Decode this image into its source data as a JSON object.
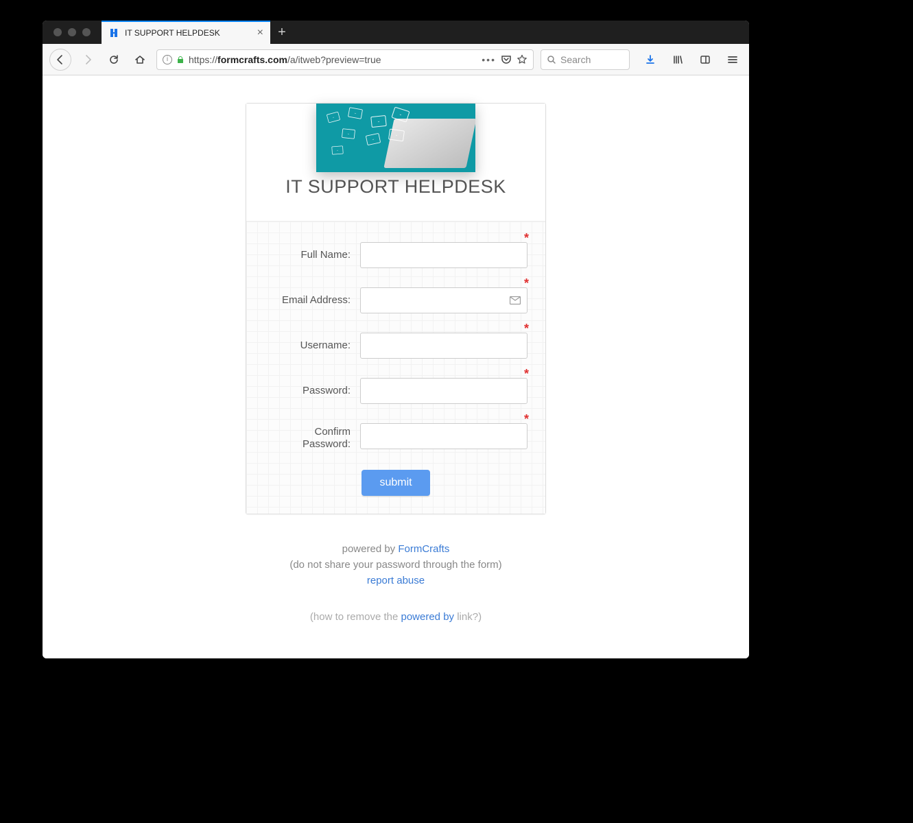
{
  "browser": {
    "tab_title": "IT SUPPORT HELPDESK",
    "url_prefix": "https://",
    "url_domain": "formcrafts.com",
    "url_path": "/a/itweb?preview=true",
    "search_placeholder": "Search"
  },
  "form": {
    "title": "IT SUPPORT HELPDESK",
    "fields": {
      "full_name": {
        "label": "Full Name:",
        "required": true
      },
      "email": {
        "label": "Email Address:",
        "required": true,
        "has_email_icon": true
      },
      "username": {
        "label": "Username:",
        "required": true
      },
      "password": {
        "label": "Password:",
        "required": true
      },
      "confirm_password": {
        "label": "Confirm Password:",
        "required": true
      }
    },
    "submit_label": "submit"
  },
  "footer": {
    "powered_by_prefix": "powered by ",
    "powered_by_link": "FormCrafts",
    "warning": "(do not share your password through the form)",
    "report_abuse": "report abuse",
    "howto_prefix": "(how to remove the ",
    "howto_link": "powered by",
    "howto_suffix": " link?)"
  }
}
